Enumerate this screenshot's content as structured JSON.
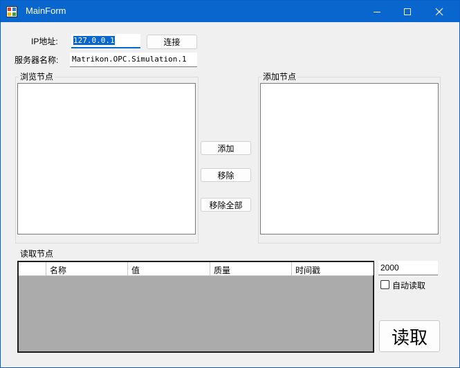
{
  "window": {
    "title": "MainForm"
  },
  "connection": {
    "ip_label": "IP地址:",
    "ip_value": "127.0.0.1",
    "connect_button": "连接",
    "server_label": "服务器名称:",
    "server_value": "Matrikon.OPC.Simulation.1"
  },
  "browse_group": {
    "title": "浏览节点"
  },
  "add_group": {
    "title": "添加节点"
  },
  "actions": {
    "add": "添加",
    "remove": "移除",
    "remove_all": "移除全部"
  },
  "read_group": {
    "title": "读取节点",
    "columns": [
      "名称",
      "值",
      "质量",
      "时间戳"
    ]
  },
  "interval": {
    "value": "2000"
  },
  "auto_read": {
    "label": "自动读取",
    "checked": false
  },
  "read_button": "读取",
  "colors": {
    "titlebar": "#0a66cf",
    "window_bg": "#f0f0f0",
    "grid_bg": "#ababab"
  }
}
